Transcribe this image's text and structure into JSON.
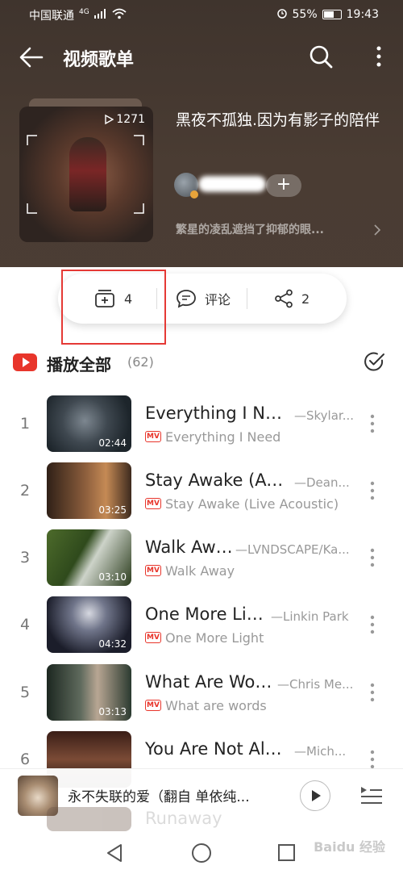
{
  "status_bar": {
    "carrier": "中国联通",
    "network": "4G",
    "battery": "55%",
    "time": "19:43"
  },
  "header": {
    "title": "视频歌单"
  },
  "playlist": {
    "play_count": "1271",
    "title": "黑夜不孤独.因为有影子的陪伴",
    "follow_symbol": "+",
    "description": "繁星的凌乱遮挡了抑郁的眼..."
  },
  "actions": {
    "collect_count": "4",
    "comment_label": "评论",
    "share_count": "2"
  },
  "play_all": {
    "label": "播放全部",
    "count": "(62)"
  },
  "songs": [
    {
      "num": "1",
      "title": "Everything I Ne...",
      "artist": "—Skylar...",
      "mv": "MV",
      "sub": "Everything I Need",
      "duration": "02:44"
    },
    {
      "num": "2",
      "title": "Stay Awake (Ac...",
      "artist": "—Dean...",
      "mv": "MV",
      "sub": "Stay Awake (Live Acoustic)",
      "duration": "03:25"
    },
    {
      "num": "3",
      "title": "Walk Away",
      "artist": "—LVNDSCAPE/Ka...",
      "mv": "MV",
      "sub": "Walk Away",
      "duration": "03:10"
    },
    {
      "num": "4",
      "title": "One More Light",
      "artist": "—Linkin Park",
      "mv": "MV",
      "sub": "One More Light",
      "duration": "04:32"
    },
    {
      "num": "5",
      "title": "What Are Words",
      "artist": "—Chris Me...",
      "mv": "MV",
      "sub": "What are words",
      "duration": "03:13"
    },
    {
      "num": "6",
      "title": "You Are Not Alo...",
      "artist": "—Mich...",
      "mv": "MV",
      "sub": "",
      "duration": ""
    }
  ],
  "ghost_row": {
    "title": "Runaway"
  },
  "mini_player": {
    "title": "永不失联的爱（翻自 单依纯..."
  },
  "watermark": "Baidu 经验"
}
